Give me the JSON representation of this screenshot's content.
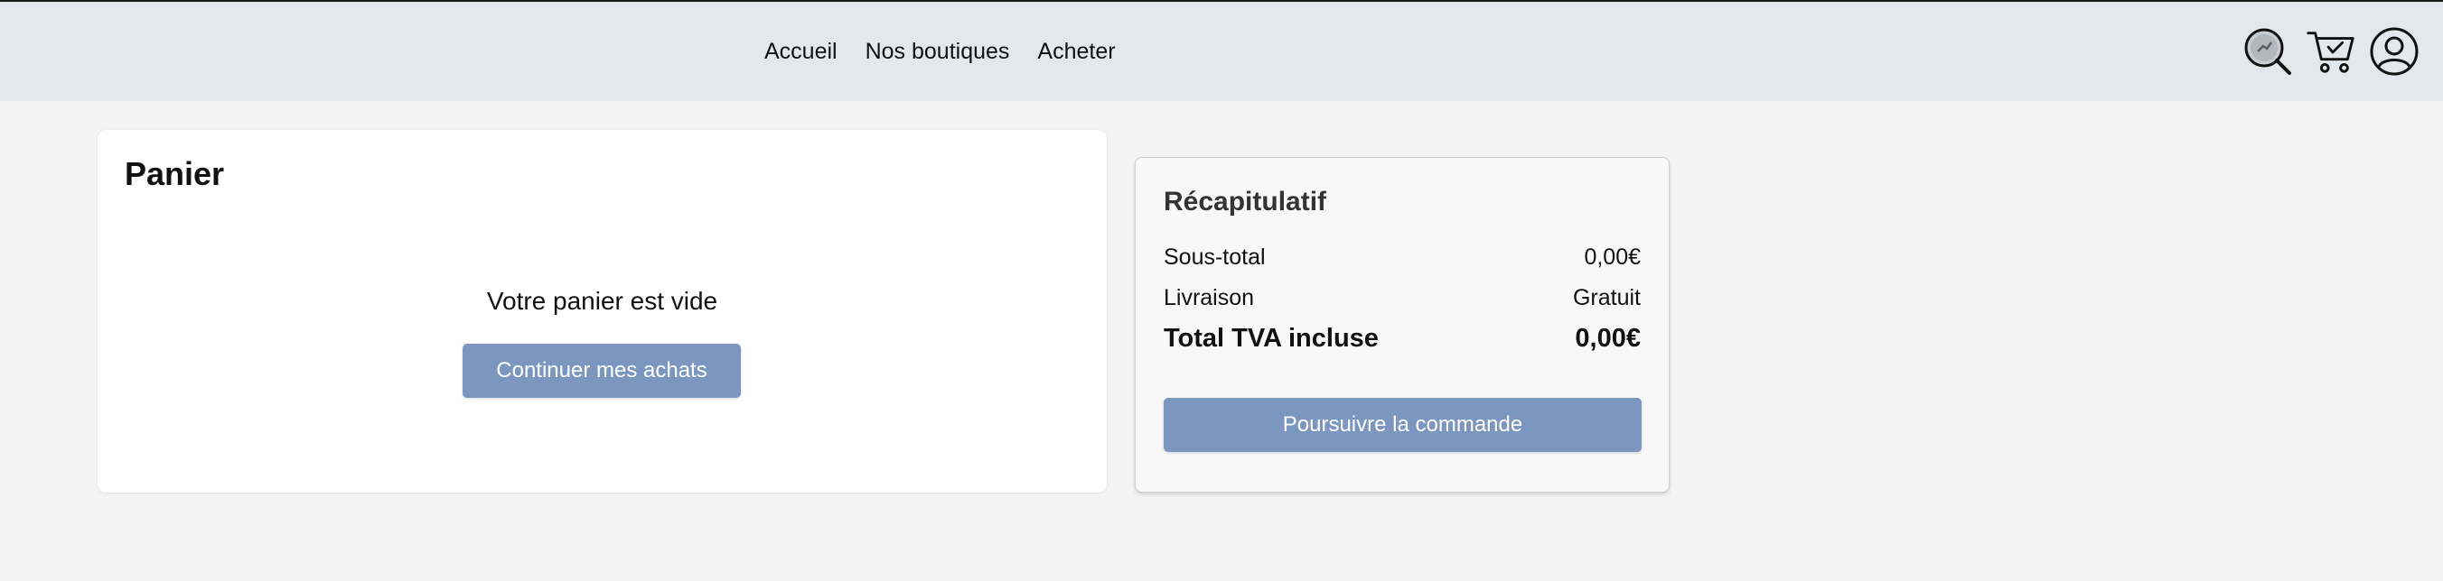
{
  "nav": {
    "items": [
      "Accueil",
      "Nos boutiques",
      "Acheter"
    ]
  },
  "header_icons": [
    "search-icon",
    "cart-icon",
    "account-icon"
  ],
  "cart": {
    "title": "Panier",
    "empty_message": "Votre panier est vide",
    "continue_label": "Continuer mes achats"
  },
  "summary": {
    "title": "Récapitulatif",
    "subtotal_label": "Sous-total",
    "subtotal_value": "0,00€",
    "shipping_label": "Livraison",
    "shipping_value": "Gratuit",
    "total_label": "Total TVA incluse",
    "total_value": "0,00€",
    "order_label": "Poursuivre la commande"
  },
  "colors": {
    "header_bg": "#e4e7eb",
    "page_bg": "#f4f4f4",
    "button_bg": "#7b96bf"
  }
}
